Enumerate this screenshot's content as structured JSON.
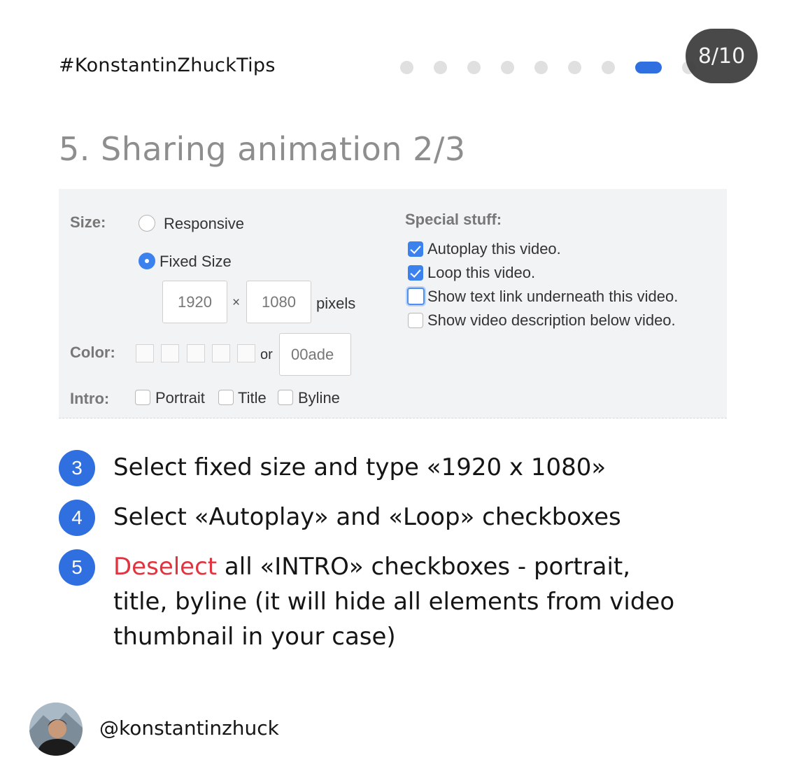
{
  "header": {
    "hashtag": "#KonstantinZhuckTips",
    "counter": "8/10"
  },
  "slide_title": "5. Sharing animation 2/3",
  "embed_settings": {
    "size_label": "Size:",
    "responsive_label": "Responsive",
    "fixed_size_label": "Fixed Size",
    "width_value": "1920",
    "times_sign": "×",
    "height_value": "1080",
    "pixels_label": "pixels",
    "color_label": "Color:",
    "or_label": "or",
    "color_value": "00ade",
    "intro_label": "Intro:",
    "intro_options": [
      "Portrait",
      "Title",
      "Byline"
    ],
    "special_label": "Special stuff:",
    "special_options": [
      "Autoplay this video.",
      "Loop this video.",
      "Show text link underneath this video.",
      "Show video description below video."
    ]
  },
  "steps": [
    {
      "num": "3",
      "text": "Select fixed size and type «1920 x 1080»"
    },
    {
      "num": "4",
      "text": "Select «Autoplay» and «Loop» checkboxes"
    },
    {
      "num": "5",
      "highlight": "Deselect",
      "line1": " all «INTRO» checkboxes - portrait,",
      "line2": "title, byline (it will hide all elements from video",
      "line3": "thumbnail in your case)"
    }
  ],
  "footer": {
    "handle": "@konstantinzhuck"
  },
  "colors": {
    "accent": "#2f6fe0",
    "highlight": "#e2333f",
    "checkbox": "#3b82ee"
  }
}
